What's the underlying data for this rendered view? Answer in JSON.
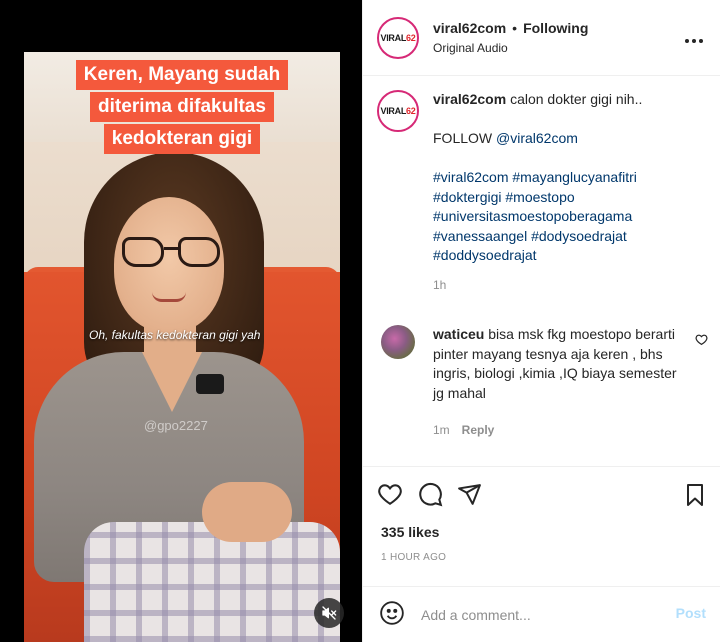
{
  "video": {
    "caption_lines": [
      "Keren, Mayang sudah",
      "diterima difakultas",
      "kedokteran gigi"
    ],
    "subtitle": "Oh, fakultas kedokteran gigi yah",
    "watermark": "@gpo2227"
  },
  "header": {
    "avatar_logo": "VIRAL62",
    "username": "viral62com",
    "separator": "•",
    "follow_status": "Following",
    "audio": "Original Audio",
    "more_icon": "more-horizontal-icon"
  },
  "caption": {
    "username": "viral62com",
    "text": "calon dokter gigi nih..",
    "follow_prefix": "FOLLOW ",
    "follow_mention": "@viral62com",
    "hashtags": "#viral62com #mayanglucyanafitri #doktergigi #moestopo #universitasmoestopoberagama #vanessaangel #dodysoedrajat #doddysoedrajat",
    "time": "1h"
  },
  "comments": [
    {
      "username": "waticeu",
      "text": "bisa msk fkg moestopo berarti pinter mayang tesnya aja keren , bhs ingris, biologi ,kimia ,IQ biaya semester jg mahal",
      "time": "1m",
      "reply_label": "Reply"
    }
  ],
  "stats": {
    "likes": "335 likes",
    "posted": "1 HOUR AGO"
  },
  "add_comment": {
    "placeholder": "Add a comment...",
    "post_label": "Post"
  },
  "colors": {
    "caption_bg": "#f4593c",
    "link": "#00376b",
    "post_disabled": "#b2dffc",
    "muted": "#8e8e8e"
  }
}
